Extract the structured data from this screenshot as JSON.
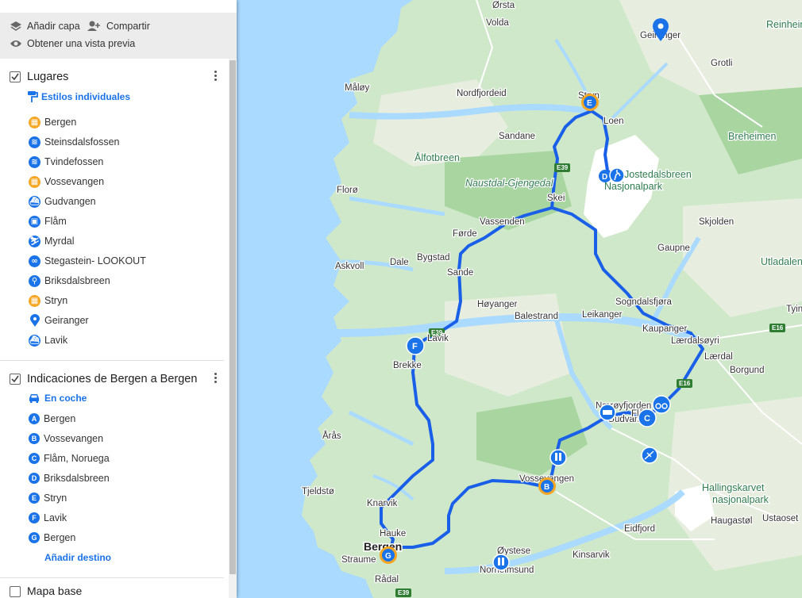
{
  "toolbar": {
    "add_layer": "Añadir capa",
    "share": "Compartir",
    "preview": "Obtener una vista previa"
  },
  "layer1": {
    "title": "Lugares",
    "style_link": "Estilos individuales",
    "items": [
      {
        "label": "Bergen",
        "icon": "city-icon",
        "color": "#f5a623"
      },
      {
        "label": "Steinsdalsfossen",
        "icon": "waterfall-icon",
        "color": "#1a73e8"
      },
      {
        "label": "Tvindefossen",
        "icon": "waterfall-icon",
        "color": "#1a73e8"
      },
      {
        "label": "Vossevangen",
        "icon": "city-icon",
        "color": "#f5a623"
      },
      {
        "label": "Gudvangen",
        "icon": "ferry-icon",
        "color": "#1a73e8"
      },
      {
        "label": "Flåm",
        "icon": "train-icon",
        "color": "#1a73e8"
      },
      {
        "label": "Myrdal",
        "icon": "ski-icon",
        "color": "#1a73e8"
      },
      {
        "label": "Stegastein- LOOKOUT",
        "icon": "binoculars-icon",
        "color": "#1a73e8"
      },
      {
        "label": "Briksdalsbreen",
        "icon": "hiking-icon",
        "color": "#1a73e8"
      },
      {
        "label": "Stryn",
        "icon": "city-icon",
        "color": "#f5a623"
      },
      {
        "label": "Geiranger",
        "icon": "location-pin-icon",
        "color": "#1a73e8"
      },
      {
        "label": "Lavik",
        "icon": "ferry-icon",
        "color": "#1a73e8"
      }
    ]
  },
  "layer2": {
    "title": "Indicaciones de Bergen a Bergen",
    "mode": "En coche",
    "stops": [
      {
        "letter": "A",
        "label": "Bergen"
      },
      {
        "letter": "B",
        "label": "Vossevangen"
      },
      {
        "letter": "C",
        "label": "Flåm, Noruega"
      },
      {
        "letter": "D",
        "label": "Briksdalsbreen"
      },
      {
        "letter": "E",
        "label": "Stryn"
      },
      {
        "letter": "F",
        "label": "Lavik"
      },
      {
        "letter": "G",
        "label": "Bergen"
      }
    ],
    "add_destination": "Añadir destino"
  },
  "layer3": {
    "title": "Mapa base"
  },
  "map": {
    "places": [
      "Ørsta",
      "Volda",
      "Geiranger",
      "Reinheim",
      "Grotli",
      "Måløy",
      "Nordfjordeid",
      "Stryn",
      "Loen",
      "Sandane",
      "Breheimen",
      "Ålfotbreen",
      "Naustdal-Gjengedal",
      "Jostedalsbreen",
      "Nasjonalpark",
      "Florø",
      "Skei",
      "Vassenden",
      "Skjolden",
      "Førde",
      "Bygstad",
      "Gaupne",
      "Dale",
      "Askvoll",
      "Sande",
      "Utladalen",
      "Høyanger",
      "Sogndalsfjøra",
      "Balestrand",
      "Leikanger",
      "Kaupanger",
      "Lærdalsøyri",
      "Tyin",
      "Lavik",
      "Lærdal",
      "Borgund",
      "Brekke",
      "Nærøyfjorden",
      "Gudvangen",
      "Flåm",
      "Hallingskarvet",
      "nasjonalpark",
      "Årås",
      "Vossevangen",
      "Tjeldstø",
      "Knarvik",
      "Haugastøl",
      "Ustaoset",
      "Hauke",
      "Eidfjord",
      "Bergen",
      "Øystese",
      "Kinsarvik",
      "Norheimsund",
      "Straume",
      "Rådal"
    ],
    "roads": [
      "E39",
      "E16",
      "E39",
      "E39",
      "E16"
    ]
  },
  "colors": {
    "route": "#1a5fe8",
    "accent": "#1a73e8",
    "city_pin": "#f5a623"
  }
}
